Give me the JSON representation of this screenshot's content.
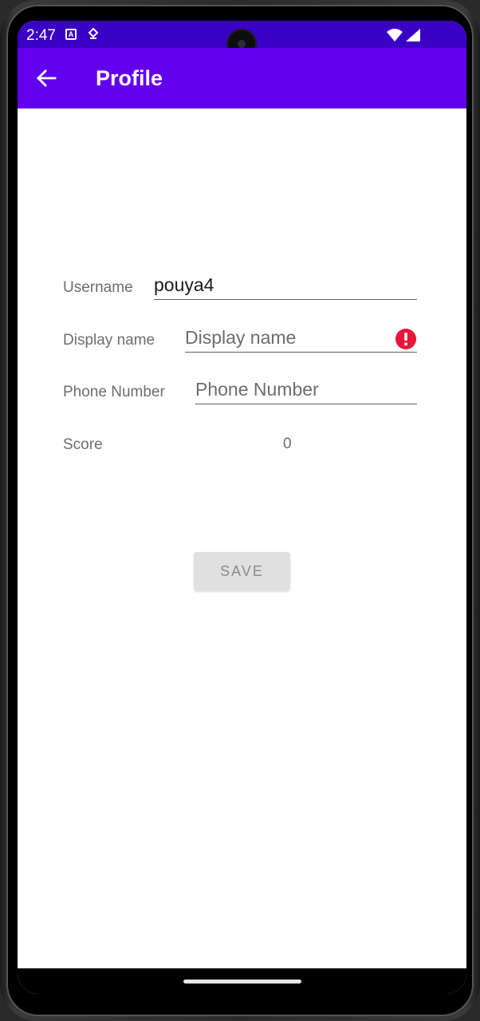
{
  "status_bar": {
    "time": "2:47",
    "notif_icon_1": "A",
    "icons": [
      "app-notification-icon",
      "location-icon",
      "wifi-icon",
      "signal-icon"
    ]
  },
  "app_bar": {
    "title": "Profile",
    "back_icon": "arrow-left-icon"
  },
  "form": {
    "username": {
      "label": "Username",
      "value": "pouya4"
    },
    "display_name": {
      "label": "Display name",
      "value": "",
      "placeholder": "Display name",
      "error_icon": "error-icon"
    },
    "phone_number": {
      "label": "Phone Number",
      "value": "",
      "placeholder": "Phone Number"
    },
    "score": {
      "label": "Score",
      "value": "0"
    }
  },
  "save_button": {
    "label": "SAVE"
  },
  "colors": {
    "status_bar": "#3a00c4",
    "app_bar": "#6200ee",
    "error": "#e8173a",
    "button_disabled_bg": "#e0e0e0"
  }
}
